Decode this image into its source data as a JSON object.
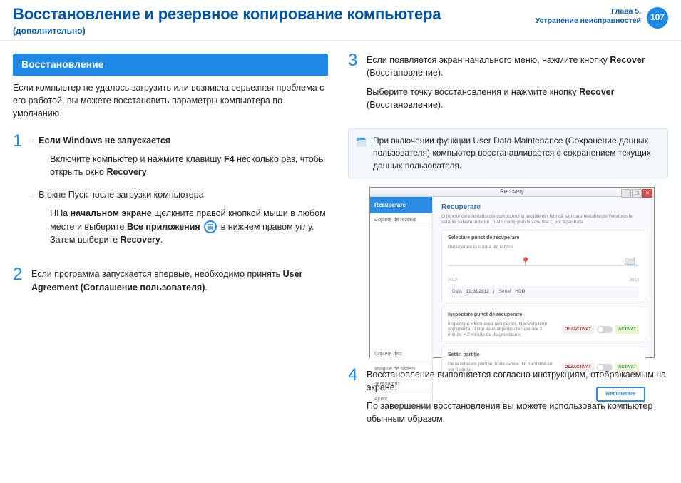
{
  "header": {
    "title": "Восстановление и резервное копирование компьютера",
    "subtitle": "(дополнительно)",
    "chapter_line1": "Глава 5.",
    "chapter_line2": "Устранение неисправностей",
    "page_number": "107"
  },
  "left": {
    "section_heading": "Восстановление",
    "intro": "Если компьютер не удалось загрузить или возникла серьезная проблема с его работой, вы можете восстановить параметры компьютера по умолчанию.",
    "step1": {
      "bullet1_title": "Если Windows не запускается",
      "bullet1_body_a": "Включите компьютер и нажмите клавишу ",
      "bullet1_key": "F4",
      "bullet1_body_b": " несколько раз, чтобы открыть окно ",
      "bullet1_recovery": "Recovery",
      "bullet1_tail": ".",
      "bullet2_title": "В окне Пуск после загрузки компьютера",
      "bullet2_a": "ННа ",
      "bullet2_bold1": "начальном экране",
      "bullet2_b": " щелкните правой кнопкой мыши в любом месте и выберите ",
      "bullet2_bold2": "Все приложения",
      "bullet2_c": " в нижнем правом углу. Затем выберите ",
      "bullet2_bold3": "Recovery",
      "bullet2_tail": "."
    },
    "step2": {
      "text_a": "Если программа запускается впервые, необходимо принять ",
      "text_bold": "User Agreement (Соглашение пользователя)",
      "text_tail": "."
    }
  },
  "right": {
    "step3": {
      "line1_a": "Если появляется экран начального меню, нажмите кнопку ",
      "line1_bold": "Recover",
      "line1_b": " (Восстановление).",
      "line2_a": "Выберите точку восстановления и нажмите кнопку ",
      "line2_bold": "Recover",
      "line2_b": " (Восстановление)."
    },
    "note": "При включении функции User Data Maintenance (Сохранение данных пользователя) компьютер восстанавливается с сохранением текущих данных пользователя.",
    "step4": {
      "p1": "Восстановление выполняется согласно инструкциям, отображаемым на экране.",
      "p2": "По завершении восстановления вы можете использовать компьютер обычным образом."
    }
  },
  "screenshot": {
    "window_title": "Recovery",
    "tab_active": "Recuperare",
    "tab_copy": "Copiere de rezervă",
    "main_heading": "Recuperare",
    "main_sub": "O funcție care restabilește computerul la setările din fabrică sau care restabilește Windows la setările salvate anterior. Toate configurațiile variabile Q vor fi păstrate.",
    "panel1_title": "Selectare punct de recuperare",
    "panel1_sub": "Recuperare la starea din fabrică",
    "year_a": "2012",
    "year_b": "2013",
    "row_date_label": "Dată",
    "row_date_val": "11.08.2012",
    "row_serial_label": "Serial",
    "row_serial_val": "HDD",
    "panel2_title": "Inspectare punct de recuperare",
    "panel2_desc": "Inspectare Efectuarea recuperării. Necesită timp suplimentar. Timp estimat pentru recuperare 2 minute + 2 minute de diagnosticare.",
    "panel3_title": "Setări partiție",
    "panel3_desc": "De la refacere partiție, toate datele din hard disk-uri vor fi șterse.",
    "toggle_off": "DEZACTIVAT",
    "toggle_on": "ACTIVAT",
    "sidebar_b1": "Copiere disc",
    "sidebar_b2": "Imagine de sistem",
    "sidebar_b3": "Test surpriz",
    "sidebar_b4": "Ajutor",
    "primary_btn": "Recuperare"
  }
}
